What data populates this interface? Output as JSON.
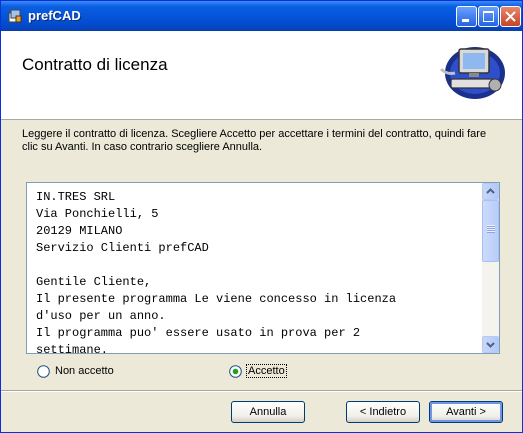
{
  "window": {
    "title": "prefCAD"
  },
  "header": {
    "title": "Contratto di licenza"
  },
  "instruction": "Leggere il contratto di licenza. Scegliere Accetto per accettare i termini del contratto, quindi fare clic su Avanti. In caso contrario scegliere Annulla.",
  "license": {
    "lines": [
      "IN.TRES SRL",
      "Via Ponchielli, 5",
      "20129 MILANO",
      "Servizio Clienti prefCAD",
      "",
      "Gentile Cliente,",
      "Il presente programma Le viene concesso in licenza",
      "d'uso per un anno.",
      "Il programma puo' essere usato in prova per 2",
      "settimane."
    ]
  },
  "radios": {
    "decline": {
      "label": "Non accetto",
      "selected": false
    },
    "accept": {
      "label": "Accetto",
      "selected": true
    }
  },
  "buttons": {
    "cancel": "Annulla",
    "back": "< Indietro",
    "next": "Avanti >"
  }
}
